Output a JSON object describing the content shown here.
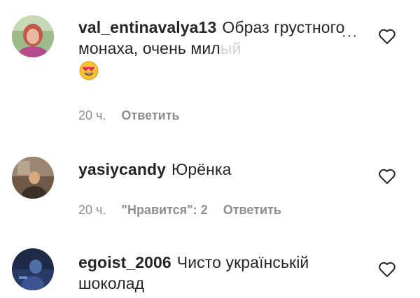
{
  "comments": [
    {
      "username": "val_entinavalya13",
      "text_main": "Образ грустного монаха, очень мил",
      "text_fade": "ый",
      "emoji": "heart-eyes-emoji",
      "time": "20 ч.",
      "reply": "Ответить",
      "more": "···"
    },
    {
      "username": "yasiycandy",
      "text_main": "Юрёнка",
      "time": "20 ч.",
      "likes": "\"Нравится\": 2",
      "reply": "Ответить"
    },
    {
      "username": "egoist_2006",
      "text_main": "Чисто українській шоколад"
    }
  ],
  "colors": {
    "text": "#262626",
    "meta": "#8e8e8e",
    "background": "#ffffff"
  }
}
